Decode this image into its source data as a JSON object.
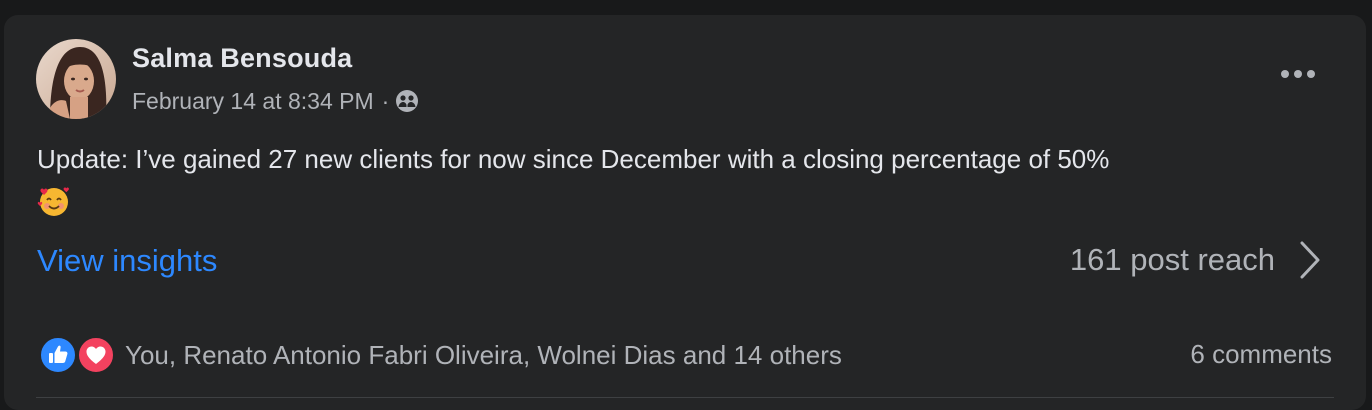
{
  "post": {
    "author_name": "Salma Bensouda",
    "timestamp": "February 14 at 8:34 PM",
    "separator": "·",
    "audience_icon": "friends-icon",
    "more_icon": "more-options-icon",
    "text": "Update: I’ve gained 27 new clients for now since December with a closing percentage of 50%",
    "emoji": "smiling-face-with-hearts",
    "insights_link": "View insights",
    "reach_text": "161 post reach",
    "reaction_icons": [
      "like-icon",
      "love-icon"
    ],
    "reactors_text": "You, Renato Antonio Fabri Oliveira, Wolnei Dias and 14 others",
    "comments_text": "6 comments"
  },
  "colors": {
    "page_bg": "#18191a",
    "card_bg": "#242526",
    "primary_text": "#e4e6eb",
    "secondary_text": "#b0b3b8",
    "link": "#2d88ff",
    "like": "#2d88ff",
    "love": "#f3425f"
  }
}
